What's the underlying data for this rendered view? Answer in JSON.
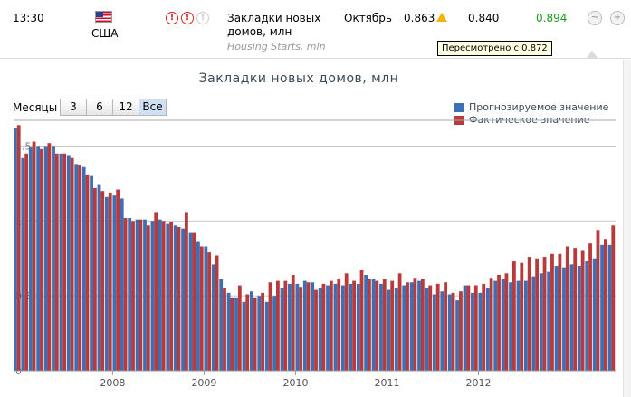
{
  "header": {
    "time": "13:30",
    "country": "США",
    "event_name_line1": "Закладки новых",
    "event_name_line2": "домов, млн",
    "event_subtitle": "Housing Starts, mln",
    "period": "Октябрь",
    "previous": "0.863",
    "forecast": "0.840",
    "actual": "0.894",
    "revised_tooltip": "Пересмотрено с 0.872",
    "importance_icons": [
      "exclamation-icon",
      "exclamation-icon",
      "exclamation-icon"
    ],
    "actual_color": "#1c9a1c"
  },
  "controls": {
    "months_label": "Месяцы",
    "buttons": [
      "3",
      "6",
      "12",
      "Все"
    ],
    "active": "Все"
  },
  "chart_data": {
    "type": "bar",
    "title": "Закладки новых домов, млн",
    "xlabel": "",
    "ylabel": "",
    "ylim": [
      0,
      1.66
    ],
    "yticks": [
      {
        "value": 0,
        "label": "0"
      },
      {
        "value": 0.5,
        "label": "0.5"
      },
      {
        "value": 1,
        "label": "1"
      },
      {
        "value": 1.5,
        "label": "1.5"
      }
    ],
    "x_tick_labels": [
      {
        "label": "2008",
        "index": 13
      },
      {
        "label": "2009",
        "index": 25
      },
      {
        "label": "2010",
        "index": 37
      },
      {
        "label": "2011",
        "index": 49
      },
      {
        "label": "2012",
        "index": 61
      }
    ],
    "legend_position": "top-right",
    "series": [
      {
        "name": "Прогнозируемое значение",
        "color": "#3d6fb5",
        "values": [
          1.62,
          1.42,
          1.49,
          1.5,
          1.5,
          1.5,
          1.45,
          1.44,
          1.38,
          1.36,
          1.3,
          1.24,
          1.16,
          1.17,
          1.15,
          1.02,
          1.01,
          1.01,
          1.0,
          1.01,
          0.98,
          0.97,
          0.95,
          0.92,
          0.86,
          0.83,
          0.71,
          0.61,
          0.52,
          0.49,
          0.46,
          0.53,
          0.5,
          0.46,
          0.5,
          0.55,
          0.58,
          0.58,
          0.6,
          0.59,
          0.55,
          0.57,
          0.58,
          0.57,
          0.58,
          0.58,
          0.64,
          0.61,
          0.58,
          0.54,
          0.55,
          0.57,
          0.59,
          0.6,
          0.55,
          0.51,
          0.53,
          0.51,
          0.47,
          0.57,
          0.52,
          0.52,
          0.55,
          0.6,
          0.61,
          0.59,
          0.6,
          0.6,
          0.63,
          0.65,
          0.66,
          0.7,
          0.69,
          0.71,
          0.7,
          0.73,
          0.75,
          0.84,
          0.84
        ]
      },
      {
        "name": "Фактическое значение",
        "color": "#b83a3a",
        "values": [
          1.64,
          1.45,
          1.53,
          1.48,
          1.52,
          1.45,
          1.45,
          1.42,
          1.37,
          1.31,
          1.22,
          1.2,
          1.19,
          1.21,
          1.02,
          1.0,
          1.01,
          0.97,
          1.06,
          1.0,
          0.99,
          0.96,
          1.06,
          0.92,
          0.83,
          0.79,
          0.77,
          0.55,
          0.49,
          0.57,
          0.51,
          0.49,
          0.52,
          0.59,
          0.6,
          0.6,
          0.64,
          0.56,
          0.59,
          0.54,
          0.58,
          0.6,
          0.61,
          0.65,
          0.6,
          0.67,
          0.61,
          0.6,
          0.61,
          0.6,
          0.65,
          0.59,
          0.62,
          0.61,
          0.57,
          0.58,
          0.59,
          0.52,
          0.53,
          0.57,
          0.57,
          0.58,
          0.62,
          0.64,
          0.65,
          0.73,
          0.72,
          0.76,
          0.75,
          0.76,
          0.78,
          0.78,
          0.83,
          0.82,
          0.8,
          0.85,
          0.94,
          0.88,
          0.97
        ]
      }
    ]
  }
}
